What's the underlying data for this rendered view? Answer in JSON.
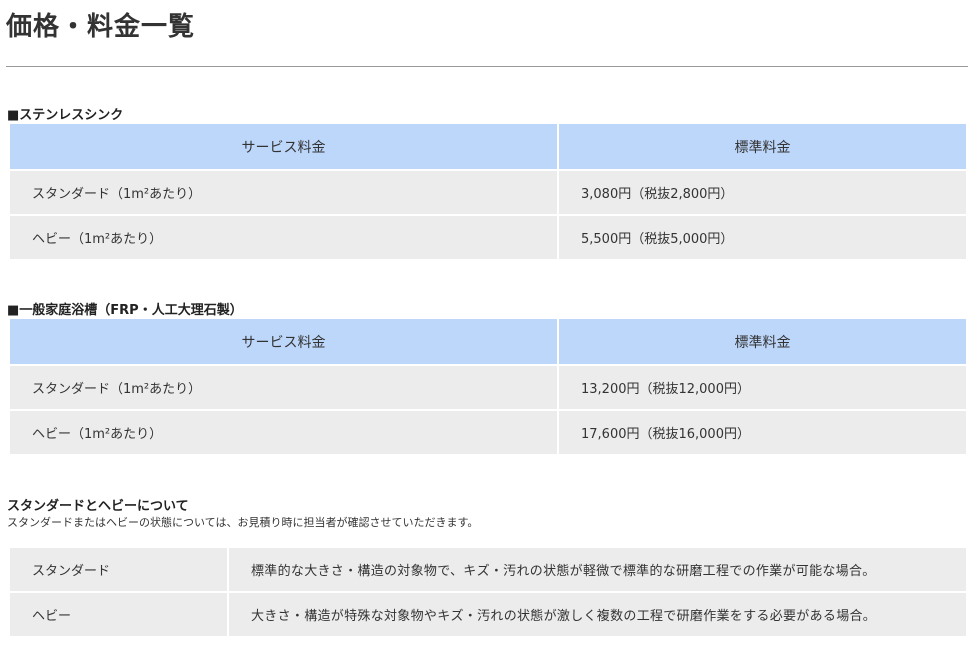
{
  "page": {
    "title": "価格・料金一覧"
  },
  "sections": [
    {
      "heading": "■ステンレスシンク",
      "headers": {
        "service": "サービス料金",
        "price": "標準料金"
      },
      "rows": [
        {
          "service": "スタンダード（1m²あたり）",
          "price": "3,080円（税抜2,800円）"
        },
        {
          "service": "ヘビー（1m²あたり）",
          "price": "5,500円（税抜5,000円）"
        }
      ]
    },
    {
      "heading": "■一般家庭浴槽（FRP・人工大理石製）",
      "headers": {
        "service": "サービス料金",
        "price": "標準料金"
      },
      "rows": [
        {
          "service": "スタンダード（1m²あたり）",
          "price": "13,200円（税抜12,000円）"
        },
        {
          "service": "ヘビー（1m²あたり）",
          "price": "17,600円（税抜16,000円）"
        }
      ]
    }
  ],
  "note": {
    "heading": "スタンダードとヘビーについて",
    "text": "スタンダードまたはヘビーの状態については、お見積り時に担当者が確認させていただきます。",
    "rows": [
      {
        "term": "スタンダード",
        "description": "標準的な大きさ・構造の対象物で、キズ・汚れの状態が軽微で標準的な研磨工程での作業が可能な場合。"
      },
      {
        "term": "ヘビー",
        "description": "大きさ・構造が特殊な対象物やキズ・汚れの状態が激しく複数の工程で研磨作業をする必要がある場合。"
      }
    ]
  },
  "colors": {
    "header_bg": "#bdd7fb",
    "cell_bg": "#ececec",
    "text": "#333333"
  }
}
